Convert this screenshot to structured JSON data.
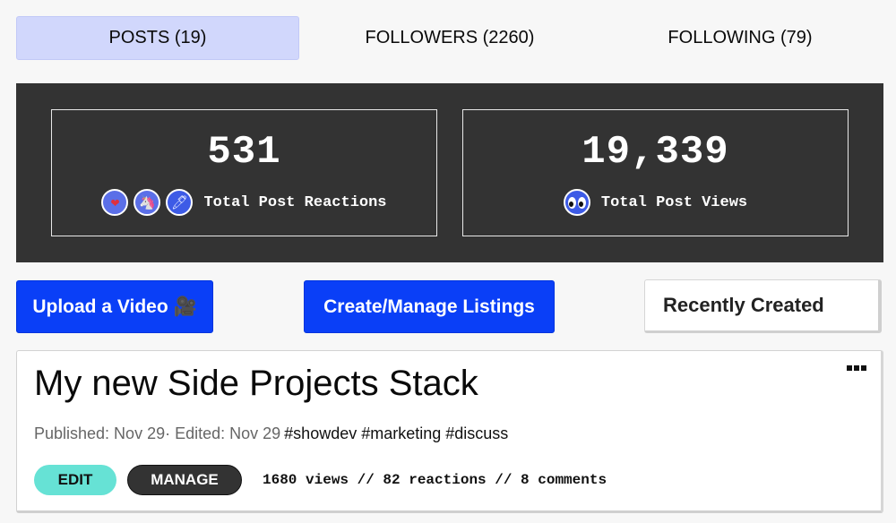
{
  "tabs": [
    {
      "label": "POSTS (19)",
      "active": true
    },
    {
      "label": "FOLLOWERS (2260)",
      "active": false
    },
    {
      "label": "FOLLOWING (79)",
      "active": false
    }
  ],
  "stats": {
    "reactions": {
      "value": "531",
      "label": "Total Post Reactions",
      "icons": [
        "heart-icon",
        "unicorn-icon",
        "rocket-icon"
      ]
    },
    "views": {
      "value": "19,339",
      "label": "Total Post Views",
      "icons": [
        "eyes-icon"
      ]
    }
  },
  "actions": {
    "upload_label": "Upload a Video 🎥",
    "listings_label": "Create/Manage Listings",
    "sort_label": "Recently Created"
  },
  "post": {
    "title": "My new Side Projects Stack",
    "published": "Published: Nov 29",
    "edited": " · Edited: Nov 29",
    "tags": "#showdev #marketing #discuss",
    "edit_label": "EDIT",
    "manage_label": "MANAGE",
    "stats": "1680 views // 82 reactions // 8 comments"
  },
  "colors": {
    "accent": "#0a3ff7",
    "tab_active": "#d1d7fc",
    "stats_bg": "#333333",
    "edit_pill": "#66e2d5"
  }
}
